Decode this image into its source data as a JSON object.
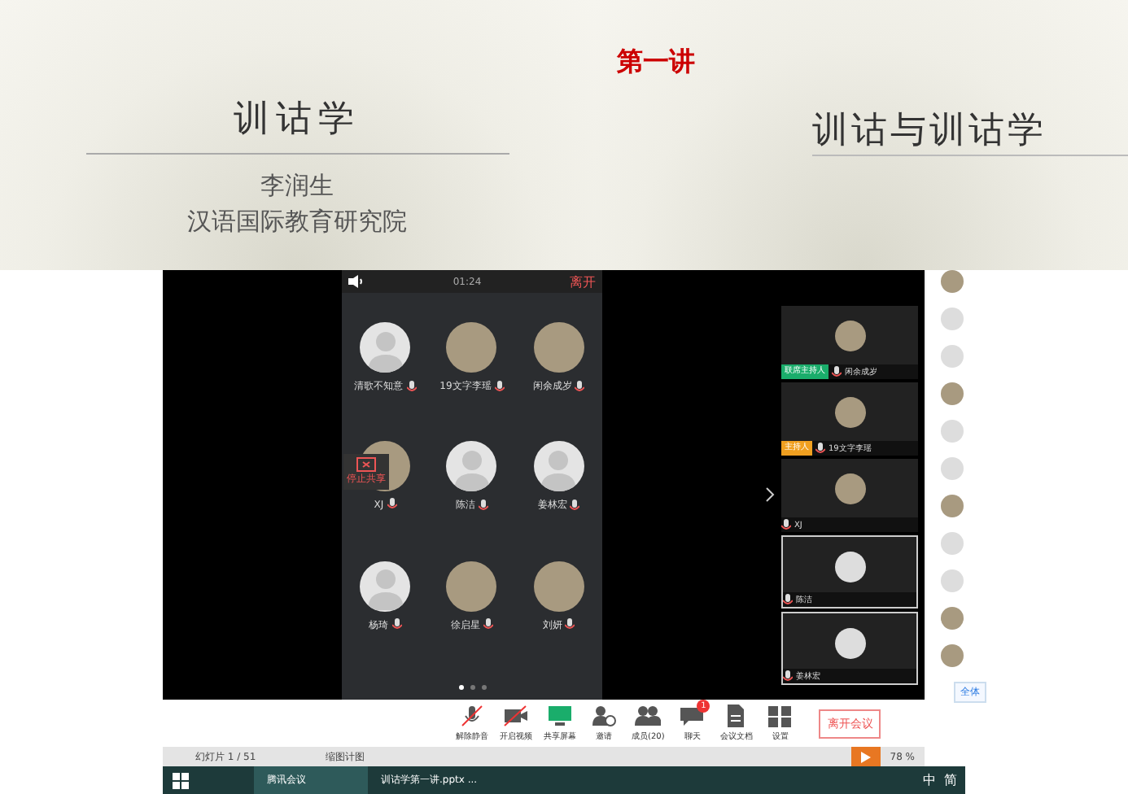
{
  "slides": [
    {
      "title": "训诂学",
      "lines": [
        "李润生",
        "汉语国际教育研究院"
      ]
    },
    {
      "label": "第一讲",
      "title": "训诂与训诂学"
    }
  ],
  "phone": {
    "timer": "01:24",
    "leave": "离开",
    "share_overlay": "停止共享",
    "participants": [
      {
        "name": "清歌不知意",
        "photo": false
      },
      {
        "name": "19文字李瑶",
        "photo": true
      },
      {
        "name": "闲余成岁",
        "photo": true
      },
      {
        "name": "XJ",
        "photo": true
      },
      {
        "name": "陈洁",
        "photo": false
      },
      {
        "name": "姜林宏",
        "photo": false
      },
      {
        "name": "杨琦",
        "photo": false
      },
      {
        "name": "徐启星",
        "photo": true
      },
      {
        "name": "刘妍",
        "photo": true
      }
    ],
    "pages": [
      {
        "selected": true
      },
      {
        "selected": false
      },
      {
        "selected": false
      }
    ]
  },
  "thumbnails": [
    {
      "role": "联席主持人",
      "color": "#1aad6b",
      "name": "闲余成岁",
      "photo": true
    },
    {
      "role": "主持人",
      "color": "#f0a020",
      "name": "19文字李瑶",
      "photo": true
    },
    {
      "name": "XJ",
      "photo": true
    },
    {
      "name": "陈洁",
      "photo": false
    },
    {
      "name": "姜林宏",
      "photo": false
    }
  ],
  "member_list": [
    {
      "photo": true
    },
    {
      "photo": false
    },
    {
      "photo": false
    },
    {
      "photo": true
    },
    {
      "photo": false
    },
    {
      "photo": false
    },
    {
      "photo": true
    },
    {
      "photo": false
    },
    {
      "photo": false
    },
    {
      "photo": true
    },
    {
      "photo": true
    }
  ],
  "member_button": "全体",
  "toolbar": [
    {
      "label": "解除静音"
    },
    {
      "label": "开启视频"
    },
    {
      "label": "共享屏幕"
    },
    {
      "label": "邀请"
    },
    {
      "label": "成员(20)"
    },
    {
      "label": "聊天",
      "badge": "1"
    },
    {
      "label": "会议文档"
    },
    {
      "label": "设置"
    }
  ],
  "leave_meeting": "离开会议",
  "status_bar": {
    "slide": "幻灯片 1 / 51",
    "notes": "缩图计图",
    "zoom": "78 %"
  },
  "taskbar": {
    "apps": [
      "腾讯会议",
      "训诂学第一讲.pptx ..."
    ],
    "ime": "中",
    "ime2": "简"
  }
}
